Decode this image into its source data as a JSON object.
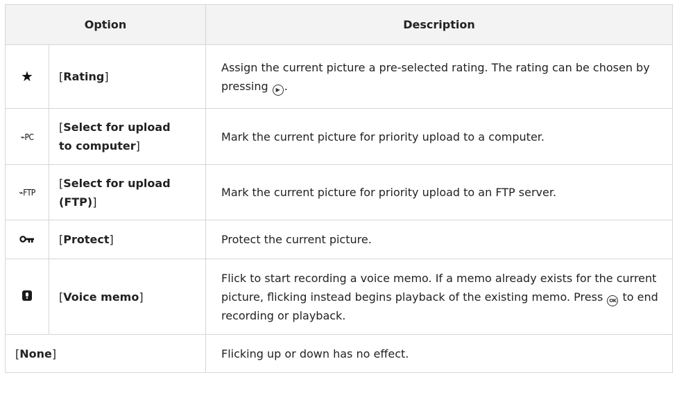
{
  "header": {
    "option": "Option",
    "description": "Description"
  },
  "rows": [
    {
      "icon": "star-icon",
      "option": "Rating",
      "description_pre": "Assign the current picture a pre-selected rating. The rating can be chosen by pressing ",
      "description_post": "."
    },
    {
      "icon": "send-to-pc-icon",
      "icon_text": "PC",
      "option_line1": "Select for upload",
      "option_line2": "to computer",
      "description": "Mark the current picture for priority upload to a computer."
    },
    {
      "icon": "send-ftp-icon",
      "icon_text": "FTP",
      "option_line1": "Select for upload",
      "option_line2": "(FTP)",
      "description": "Mark the current picture for priority upload to an FTP server."
    },
    {
      "icon": "key-icon",
      "option": "Protect",
      "description": "Protect the current picture."
    },
    {
      "icon": "microphone-icon",
      "option": "Voice memo",
      "description_pre": "Flick to start recording a voice memo. If a memo already exists for the current picture, flicking instead begins playback of the existing memo. Press ",
      "ok_label": "OK",
      "description_post": " to end recording or playback."
    },
    {
      "option": "None",
      "description": "Flicking up or down has no effect."
    }
  ]
}
